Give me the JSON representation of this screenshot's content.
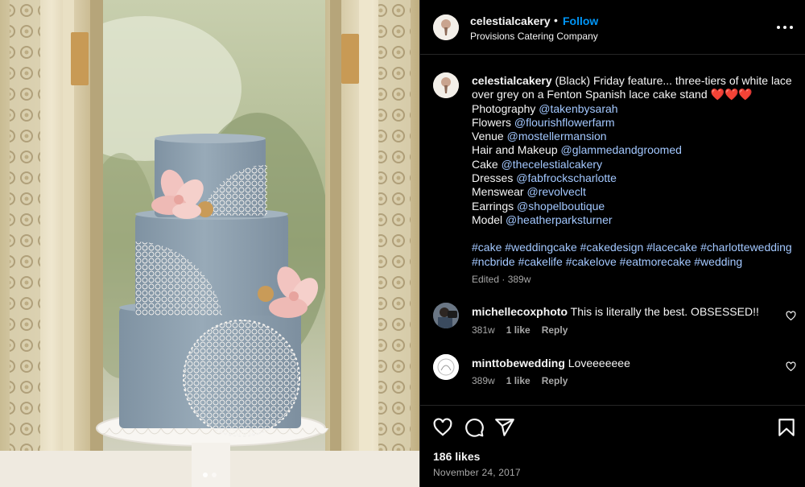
{
  "post": {
    "image_alt": "Three-tier grey wedding cake with white lace and pink sugar flowers"
  },
  "header": {
    "username": "celestialcakery",
    "separator": "•",
    "follow_label": "Follow",
    "location": "Provisions Catering Company",
    "more_icon": "more-options-icon"
  },
  "caption": {
    "username": "celestialcakery",
    "text": " (Black) Friday feature... three-tiers of white lace over grey on a Fenton Spanish lace cake stand ❤️❤️❤️",
    "credits": [
      {
        "label": "Photography",
        "handle": "@takenbysarah"
      },
      {
        "label": "Flowers",
        "handle": "@flourishflowerfarm"
      },
      {
        "label": "Venue",
        "handle": "@mostellermansion"
      },
      {
        "label": "Hair and Makeup",
        "handle": "@glammedandgroomed"
      },
      {
        "label": "Cake",
        "handle": "@thecelestialcakery"
      },
      {
        "label": "Dresses",
        "handle": "@fabfrockscharlotte"
      },
      {
        "label": "Menswear",
        "handle": "@revolveclt"
      },
      {
        "label": "Earrings",
        "handle": "@shopelboutique"
      },
      {
        "label": "Model",
        "handle": "@heatherparksturner"
      }
    ],
    "hashtags_line1": "#cake #weddingcake #cakedesign #lacecake #charlottewedding",
    "hashtags_line2": "#ncbride #cakelife #cakelove #eatmorecake #wedding",
    "meta": "Edited · 389w"
  },
  "comments": [
    {
      "username": "michellecoxphoto",
      "text": " This is literally the best. OBSESSED!!",
      "age": "381w",
      "likes": "1 like",
      "reply": "Reply"
    },
    {
      "username": "minttobewedding",
      "text": " Loveeeeeee",
      "age": "389w",
      "likes": "1 like",
      "reply": "Reply"
    }
  ],
  "actions": {
    "like_icon": "heart-icon",
    "comment_icon": "comment-icon",
    "share_icon": "share-icon",
    "save_icon": "bookmark-icon",
    "likes": "186 likes",
    "date": "November 24, 2017"
  },
  "colors": {
    "background": "#000000",
    "text": "#f5f5f5",
    "secondary_text": "#a8a8a8",
    "link": "#a3c8ff",
    "follow": "#0095f6",
    "cake_grey": "#8c9caa",
    "flower_pink": "#f2c4c0"
  }
}
